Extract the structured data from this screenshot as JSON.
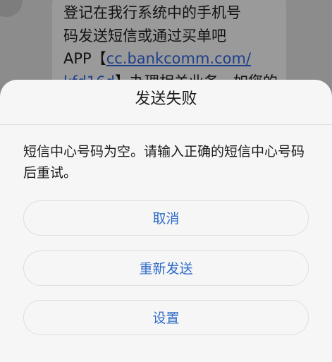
{
  "message": {
    "line1": "登记在我行系统中的手机号",
    "line2": "码发送短信或通过买单吧",
    "line3_prefix": "APP【",
    "link_part1": "cc.bankcomm.com/",
    "link_part2": "kfd16d",
    "line4_suffix": "】办理相关业务。如您的手"
  },
  "dialog": {
    "title": "发送失败",
    "message": "短信中心号码为空。请输入正确的短信中心号码后重试。",
    "buttons": {
      "cancel": "取消",
      "resend": "重新发送",
      "settings": "设置"
    }
  },
  "colors": {
    "accent": "#2f6bc8",
    "link": "#1d3f8a",
    "dialog_bg": "#f6f6f6"
  }
}
